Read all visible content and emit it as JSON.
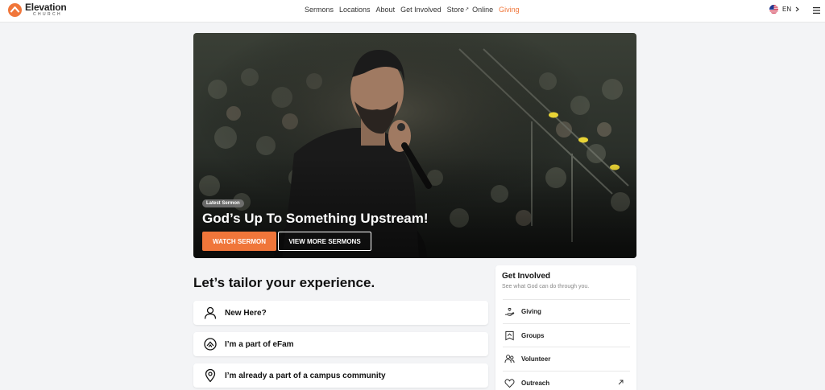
{
  "header": {
    "logo": {
      "name": "Elevation",
      "sub": "CHURCH",
      "icon": "elevation-logo-icon",
      "color": "#f0763a"
    },
    "nav": [
      {
        "label": "Sermons"
      },
      {
        "label": "Locations"
      },
      {
        "label": "About"
      },
      {
        "label": "Get Involved"
      },
      {
        "label": "Store",
        "external": true
      },
      {
        "label": "Online"
      },
      {
        "label": "Giving",
        "accent": true
      }
    ],
    "language": {
      "code": "EN",
      "icon": "us-flag-icon"
    },
    "menu_icon": "hamburger-menu-icon"
  },
  "hero": {
    "badge": "Latest Sermon",
    "title": "God’s Up To Something Upstream!",
    "watch_label": "WATCH SERMON",
    "more_label": "VIEW MORE SERMONS",
    "accent": "#f0763a"
  },
  "tailor": {
    "title": "Let’s tailor your experience.",
    "options": [
      {
        "label": "New Here?",
        "icon": "person-icon"
      },
      {
        "label": "I’m a part of eFam",
        "icon": "efam-icon"
      },
      {
        "label": "I’m already a part of a campus community",
        "icon": "location-pin-icon"
      }
    ]
  },
  "get_involved": {
    "title": "Get Involved",
    "subtitle": "See what God can do through you.",
    "items": [
      {
        "label": "Giving",
        "icon": "giving-hand-icon"
      },
      {
        "label": "Groups",
        "icon": "groups-icon"
      },
      {
        "label": "Volunteer",
        "icon": "volunteer-icon"
      },
      {
        "label": "Outreach",
        "icon": "heart-icon",
        "external": true
      }
    ]
  }
}
